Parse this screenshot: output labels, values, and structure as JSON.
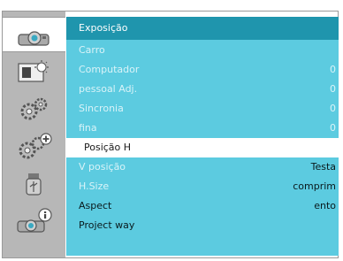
{
  "menu": {
    "title": "Exposição",
    "items": [
      {
        "label": "Carro",
        "value": ""
      },
      {
        "label": "Computador",
        "value": "0"
      },
      {
        "label": "pessoal Adj.",
        "value": "0"
      },
      {
        "label": "Sincronia",
        "value": "0"
      },
      {
        "label": "fina",
        "value": "0"
      },
      {
        "label": "Posição H",
        "value": ""
      },
      {
        "label": "V posição",
        "value": "Testa"
      },
      {
        "label": "H.Size",
        "value": "comprim"
      },
      {
        "label": "Aspect",
        "value": "ento"
      },
      {
        "label": "Project way",
        "value": ""
      }
    ]
  },
  "sidebar": {
    "tabs": [
      {
        "icon": "projector-icon"
      },
      {
        "icon": "image-adjust-icon"
      },
      {
        "icon": "gears-icon"
      },
      {
        "icon": "gears-plus-icon"
      },
      {
        "icon": "usb-icon"
      },
      {
        "icon": "projector-info-icon"
      }
    ]
  },
  "colors": {
    "panel": "#5ccbe0",
    "title_bar": "#1f95ad",
    "sidebar": "#b7b7b7",
    "disabled_text": "#d9f3f8",
    "enabled_text": "#0a1a1d",
    "selected_row": "#ffffff"
  }
}
